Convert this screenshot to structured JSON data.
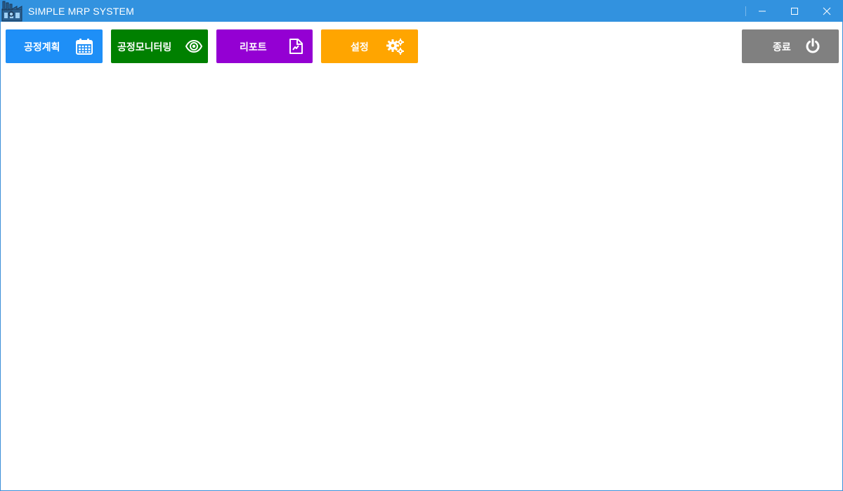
{
  "window": {
    "title": "SIMPLE MRP SYSTEM",
    "icon": "factory-icon",
    "controls": [
      "minimize-icon",
      "maximize-icon",
      "close-icon"
    ],
    "title_color": "#3292df"
  },
  "toolbar": {
    "buttons": [
      {
        "label": "공정계획",
        "icon": "calendar-icon",
        "color": "#1e8ff7"
      },
      {
        "label": "공정모니터링",
        "icon": "eye-icon",
        "color": "#008000"
      },
      {
        "label": "리포트",
        "icon": "file-chart-icon",
        "color": "#9400d3"
      },
      {
        "label": "설정",
        "icon": "gears-icon",
        "color": "#ffa500"
      },
      {
        "label": "종료",
        "icon": "power-icon",
        "color": "#808080"
      }
    ]
  }
}
